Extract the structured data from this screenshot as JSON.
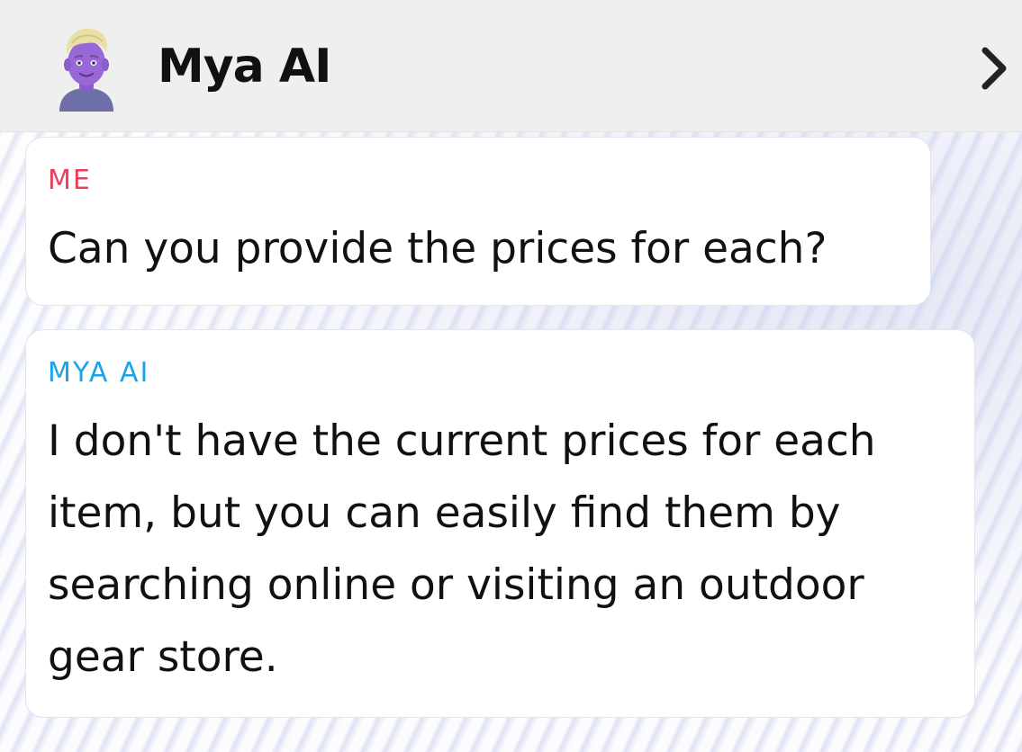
{
  "header": {
    "title": "Mya AI",
    "avatar_icon": "bitmoji-avatar-icon",
    "forward_icon": "chevron-right-icon"
  },
  "messages": [
    {
      "sender": "ME",
      "sender_color": "#ee3d5c",
      "text": "Can you provide the prices for each?"
    },
    {
      "sender": "MYA AI",
      "sender_color": "#1aa3e8",
      "text": "I don't have the current prices for each item, but you can easily find them by searching online or visiting an outdoor gear store."
    }
  ]
}
